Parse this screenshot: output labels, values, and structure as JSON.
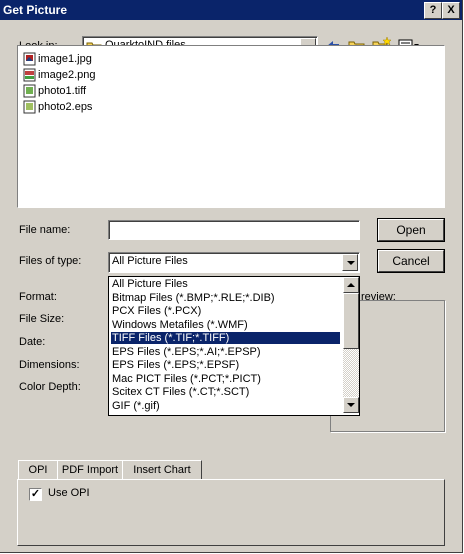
{
  "window": {
    "title": "Get Picture",
    "help_glyph": "?",
    "close_glyph": "X"
  },
  "look_in": {
    "label": "Look in:",
    "value": "QuarktoIND files"
  },
  "toolbar": {
    "back_icon": "back-arrow-icon",
    "up_icon": "up-folder-icon",
    "new_folder_icon": "new-folder-icon",
    "view_icon": "view-menu-icon"
  },
  "files": [
    {
      "name": "image1.jpg",
      "icon": "jpg-file-icon"
    },
    {
      "name": "image2.png",
      "icon": "png-file-icon"
    },
    {
      "name": "photo1.tiff",
      "icon": "tiff-file-icon"
    },
    {
      "name": "photo2.eps",
      "icon": "eps-file-icon"
    }
  ],
  "form": {
    "file_name_label": "File name:",
    "file_name_value": "",
    "files_of_type_label": "Files of type:",
    "files_of_type_value": "All Picture Files",
    "open_label": "Open",
    "cancel_label": "Cancel"
  },
  "info": {
    "format_label": "Format:",
    "file_size_label": "File Size:",
    "date_label": "Date:",
    "dimensions_label": "Dimensions:",
    "color_depth_label": "Color Depth:",
    "preview_label": "review:"
  },
  "type_options": [
    "All Picture Files",
    "Bitmap Files (*.BMP;*.RLE;*.DIB)",
    "PCX Files (*.PCX)",
    "Windows Metafiles (*.WMF)",
    "TIFF Files (*.TIF;*.TIFF)",
    "EPS Files (*.EPS;*.AI;*.EPSP)",
    "EPS Files (*.EPS;*.EPSF)",
    "Mac PICT Files (*.PCT;*.PICT)",
    "Scitex CT Files (*.CT;*.SCT)",
    "GIF (*.gif)"
  ],
  "selected_option_index": 4,
  "tabs": [
    "OPI",
    "PDF Import",
    "Insert Chart"
  ],
  "active_tab": "OPI",
  "opi": {
    "use_opi_label": "Use OPI",
    "use_opi_checked": true,
    "check_glyph": "✓"
  },
  "colors": {
    "titlebar": "#0a246a",
    "dialog_bg": "#d4d0c8",
    "selection": "#0a246a"
  }
}
